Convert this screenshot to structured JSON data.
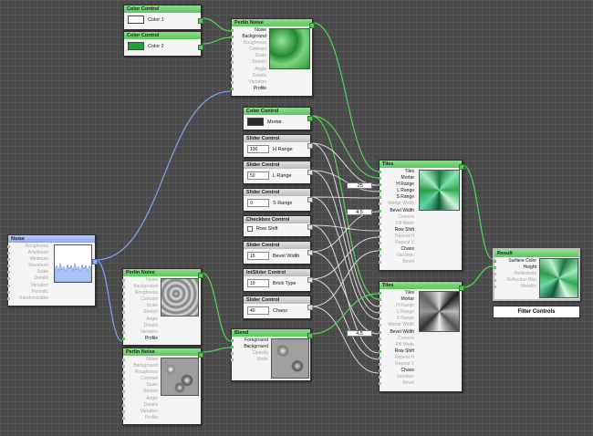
{
  "colors": {
    "green": "#5fc45f",
    "blue": "#8aa6ef",
    "grey": "#bdbdbd",
    "wire_green": "#4ed84e",
    "wire_blue": "#7ea3f5",
    "wire_white": "#d8d8d8"
  },
  "color_control_1": {
    "title": "Color Control",
    "label": "Color 1",
    "swatch": "#ffffff"
  },
  "color_control_2": {
    "title": "Color Control",
    "label": "Color 2",
    "swatch": "#17a52f"
  },
  "perlin_top": {
    "title": "Perlin Noise",
    "ports": [
      "Noise",
      "Background",
      "Roughness",
      "Contrast",
      "Scale",
      "Stretch",
      "Angle",
      "Details",
      "Variation",
      "Profile"
    ]
  },
  "color_mortar": {
    "title": "Color Control",
    "label": "Mortar",
    "swatch": "#2a2a2a"
  },
  "sliders": [
    {
      "title": "Slider Control",
      "value": "100",
      "label": "H Range"
    },
    {
      "title": "Slider Control",
      "value": "50",
      "label": "L Range"
    },
    {
      "title": "Slider Control",
      "value": "0",
      "label": "S Range"
    }
  ],
  "checkbox_ctrl": {
    "title": "Checkbox Control",
    "label": "Row Shift"
  },
  "slider_bevel": {
    "title": "Slider Control",
    "value": "15",
    "label": "Bevel Width"
  },
  "int_slider": {
    "title": "IntSlider Control",
    "value": "10",
    "label": "Brick Type"
  },
  "slider_chaos": {
    "title": "Slider Control",
    "value": "40",
    "label": "Chaos"
  },
  "noise": {
    "title": "Noise",
    "ports": [
      "Roughness",
      "Amplitude",
      "Minimum",
      "Maximum",
      "Scale",
      "Details",
      "Variation",
      "Periodic",
      "Randomizable"
    ]
  },
  "perlin_mid": {
    "title": "Perlin Noise",
    "ports": [
      "Noise",
      "Background",
      "Roughness",
      "Contrast",
      "Scale",
      "Stretch",
      "Angle",
      "Details",
      "Variation",
      "Profile"
    ]
  },
  "perlin_bot": {
    "title": "Perlin Noise",
    "ports": [
      "Noise",
      "Background",
      "Roughness",
      "Contrast",
      "Scale",
      "Stretch",
      "Angle",
      "Details",
      "Variation",
      "Profile"
    ]
  },
  "blend": {
    "title": "Blend",
    "ports": [
      "Foreground",
      "Background",
      "Opacity",
      "Mode"
    ]
  },
  "tiles_top": {
    "title": "Tiles",
    "ports": [
      "Tiles",
      "Mortar",
      "H Range",
      "L Range",
      "S Range",
      "Mortar Width",
      "Bevel Width",
      "Corners",
      "Fill Mode",
      "Row Shift",
      "Repeat H",
      "Repeat V",
      "Chaos",
      "Variation",
      "Bevel"
    ],
    "badge1": ".25",
    "badge2": "4.5"
  },
  "tiles_bot": {
    "title": "Tiles",
    "ports": [
      "Tiles",
      "Mortar",
      "H Range",
      "L Range",
      "S Range",
      "Mortar Width",
      "Bevel Width",
      "Corners",
      "Fill Mode",
      "Row Shift",
      "Repeat H",
      "Repeat V",
      "Chaos",
      "Variation",
      "Bevel"
    ],
    "badge1": "4.5"
  },
  "result": {
    "title": "Result",
    "ports": [
      "Surface Color",
      "Height",
      "Reflectivity",
      "Reflection Blur",
      "Metallic"
    ]
  },
  "filter_controls": "Filter Controls"
}
